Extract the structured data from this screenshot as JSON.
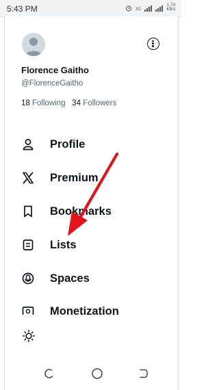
{
  "status_bar": {
    "time": "5:43 PM",
    "network_label": "3G",
    "data_speed": "1.70 KB/s"
  },
  "profile": {
    "display_name": "Florence Gaitho",
    "handle": "@FlorenceGaitho",
    "following_count": "18",
    "following_label": "Following",
    "followers_count": "34",
    "followers_label": "Followers"
  },
  "menu": {
    "items": [
      {
        "label": "Profile",
        "icon": "person-icon"
      },
      {
        "label": "Premium",
        "icon": "x-logo-icon"
      },
      {
        "label": "Bookmarks",
        "icon": "bookmark-icon"
      },
      {
        "label": "Lists",
        "icon": "lists-icon"
      },
      {
        "label": "Spaces",
        "icon": "spaces-icon"
      },
      {
        "label": "Monetization",
        "icon": "monetization-icon"
      }
    ]
  },
  "annotation": {
    "arrow_color": "#e0141b"
  },
  "colors": {
    "text_primary": "#0f1419",
    "text_secondary": "#536471",
    "avatar_bg": "#cfd9de"
  }
}
